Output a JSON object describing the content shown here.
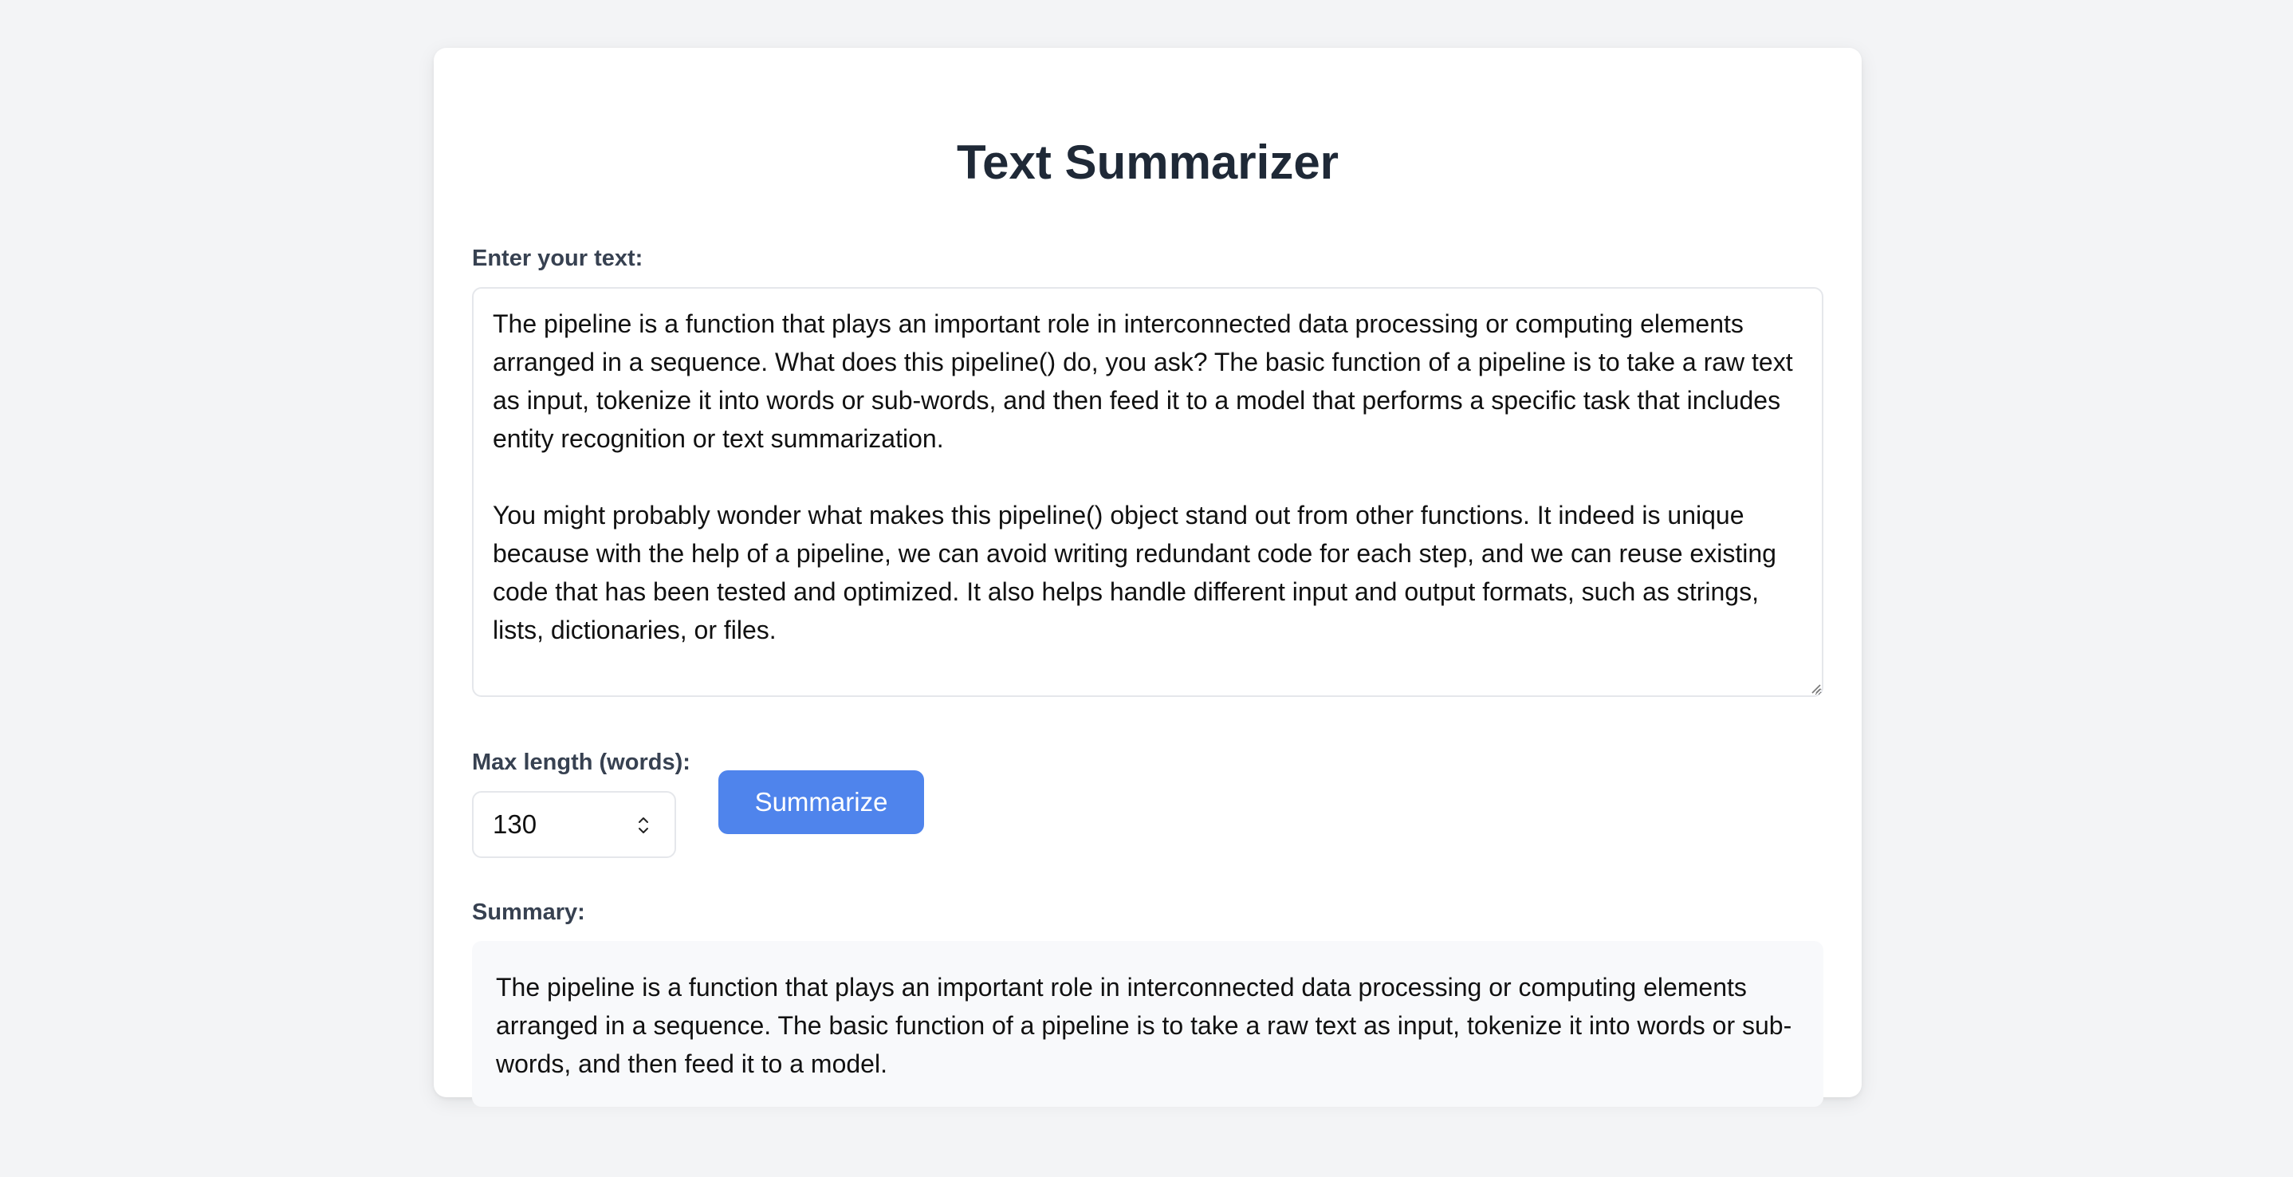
{
  "app": {
    "title": "Text Summarizer"
  },
  "input": {
    "label": "Enter your text:",
    "value": "The pipeline is a function that plays an important role in interconnected data processing or computing elements arranged in a sequence. What does this pipeline() do, you ask? The basic function of a pipeline is to take a raw text as input, tokenize it into words or sub-words, and then feed it to a model that performs a specific task that includes entity recognition or text summarization.\n\nYou might probably wonder what makes this pipeline() object stand out from other functions. It indeed is unique because with the help of a pipeline, we can avoid writing redundant code for each step, and we can reuse existing code that has been tested and optimized. It also helps handle different input and output formats, such as strings, lists, dictionaries, or files."
  },
  "controls": {
    "max_length_label": "Max length (words):",
    "max_length_value": "130",
    "summarize_label": "Summarize"
  },
  "summary": {
    "label": "Summary:",
    "text": "The pipeline is a function that plays an important role in interconnected data processing or computing elements arranged in a sequence. The basic function of a pipeline is to take a raw text as input, tokenize it into words or sub-words, and then feed it to a model."
  },
  "colors": {
    "page_background": "#f3f4f6",
    "accent": "#4f84ec",
    "title_text": "#1f2937",
    "label_text": "#374151",
    "summary_background": "#f8f9fb"
  },
  "icons": {
    "spinner": "up-down-spinner-icon",
    "resize": "resize-handle-icon"
  }
}
